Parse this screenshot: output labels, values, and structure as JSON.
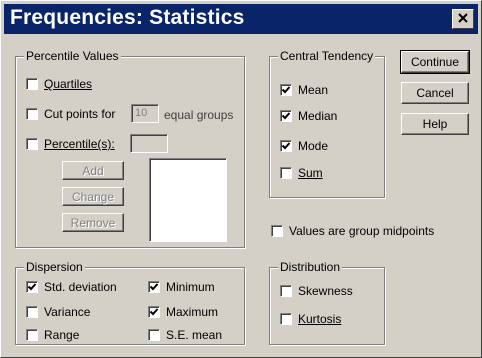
{
  "title": "Frequencies: Statistics",
  "percentile": {
    "legend": "Percentile Values",
    "quartiles": {
      "label": "Quartiles",
      "checked": false
    },
    "cutpoints": {
      "label": "Cut points for",
      "value": "10",
      "suffix": "equal groups",
      "checked": false
    },
    "percentiles": {
      "label": "Percentile(s):",
      "checked": false
    },
    "add": "Add",
    "change": "Change",
    "remove": "Remove"
  },
  "central": {
    "legend": "Central Tendency",
    "items": [
      {
        "label": "Mean",
        "checked": true
      },
      {
        "label": "Median",
        "checked": true
      },
      {
        "label": "Mode",
        "checked": true
      },
      {
        "label": "Sum",
        "checked": false
      }
    ]
  },
  "buttons": {
    "continue": "Continue",
    "cancel": "Cancel",
    "help": "Help"
  },
  "group_midpoints": {
    "label": "Values are group midpoints",
    "checked": false
  },
  "dispersion": {
    "legend": "Dispersion",
    "items": [
      {
        "label": "Std. deviation",
        "checked": true
      },
      {
        "label": "Minimum",
        "checked": true
      },
      {
        "label": "Variance",
        "checked": false
      },
      {
        "label": "Maximum",
        "checked": true
      },
      {
        "label": "Range",
        "checked": false
      },
      {
        "label": "S.E. mean",
        "checked": false
      }
    ]
  },
  "distribution": {
    "legend": "Distribution",
    "items": [
      {
        "label": "Skewness",
        "checked": false
      },
      {
        "label": "Kurtosis",
        "checked": false
      }
    ]
  },
  "icons": {
    "close": "close-icon",
    "check": "checkmark-icon"
  }
}
